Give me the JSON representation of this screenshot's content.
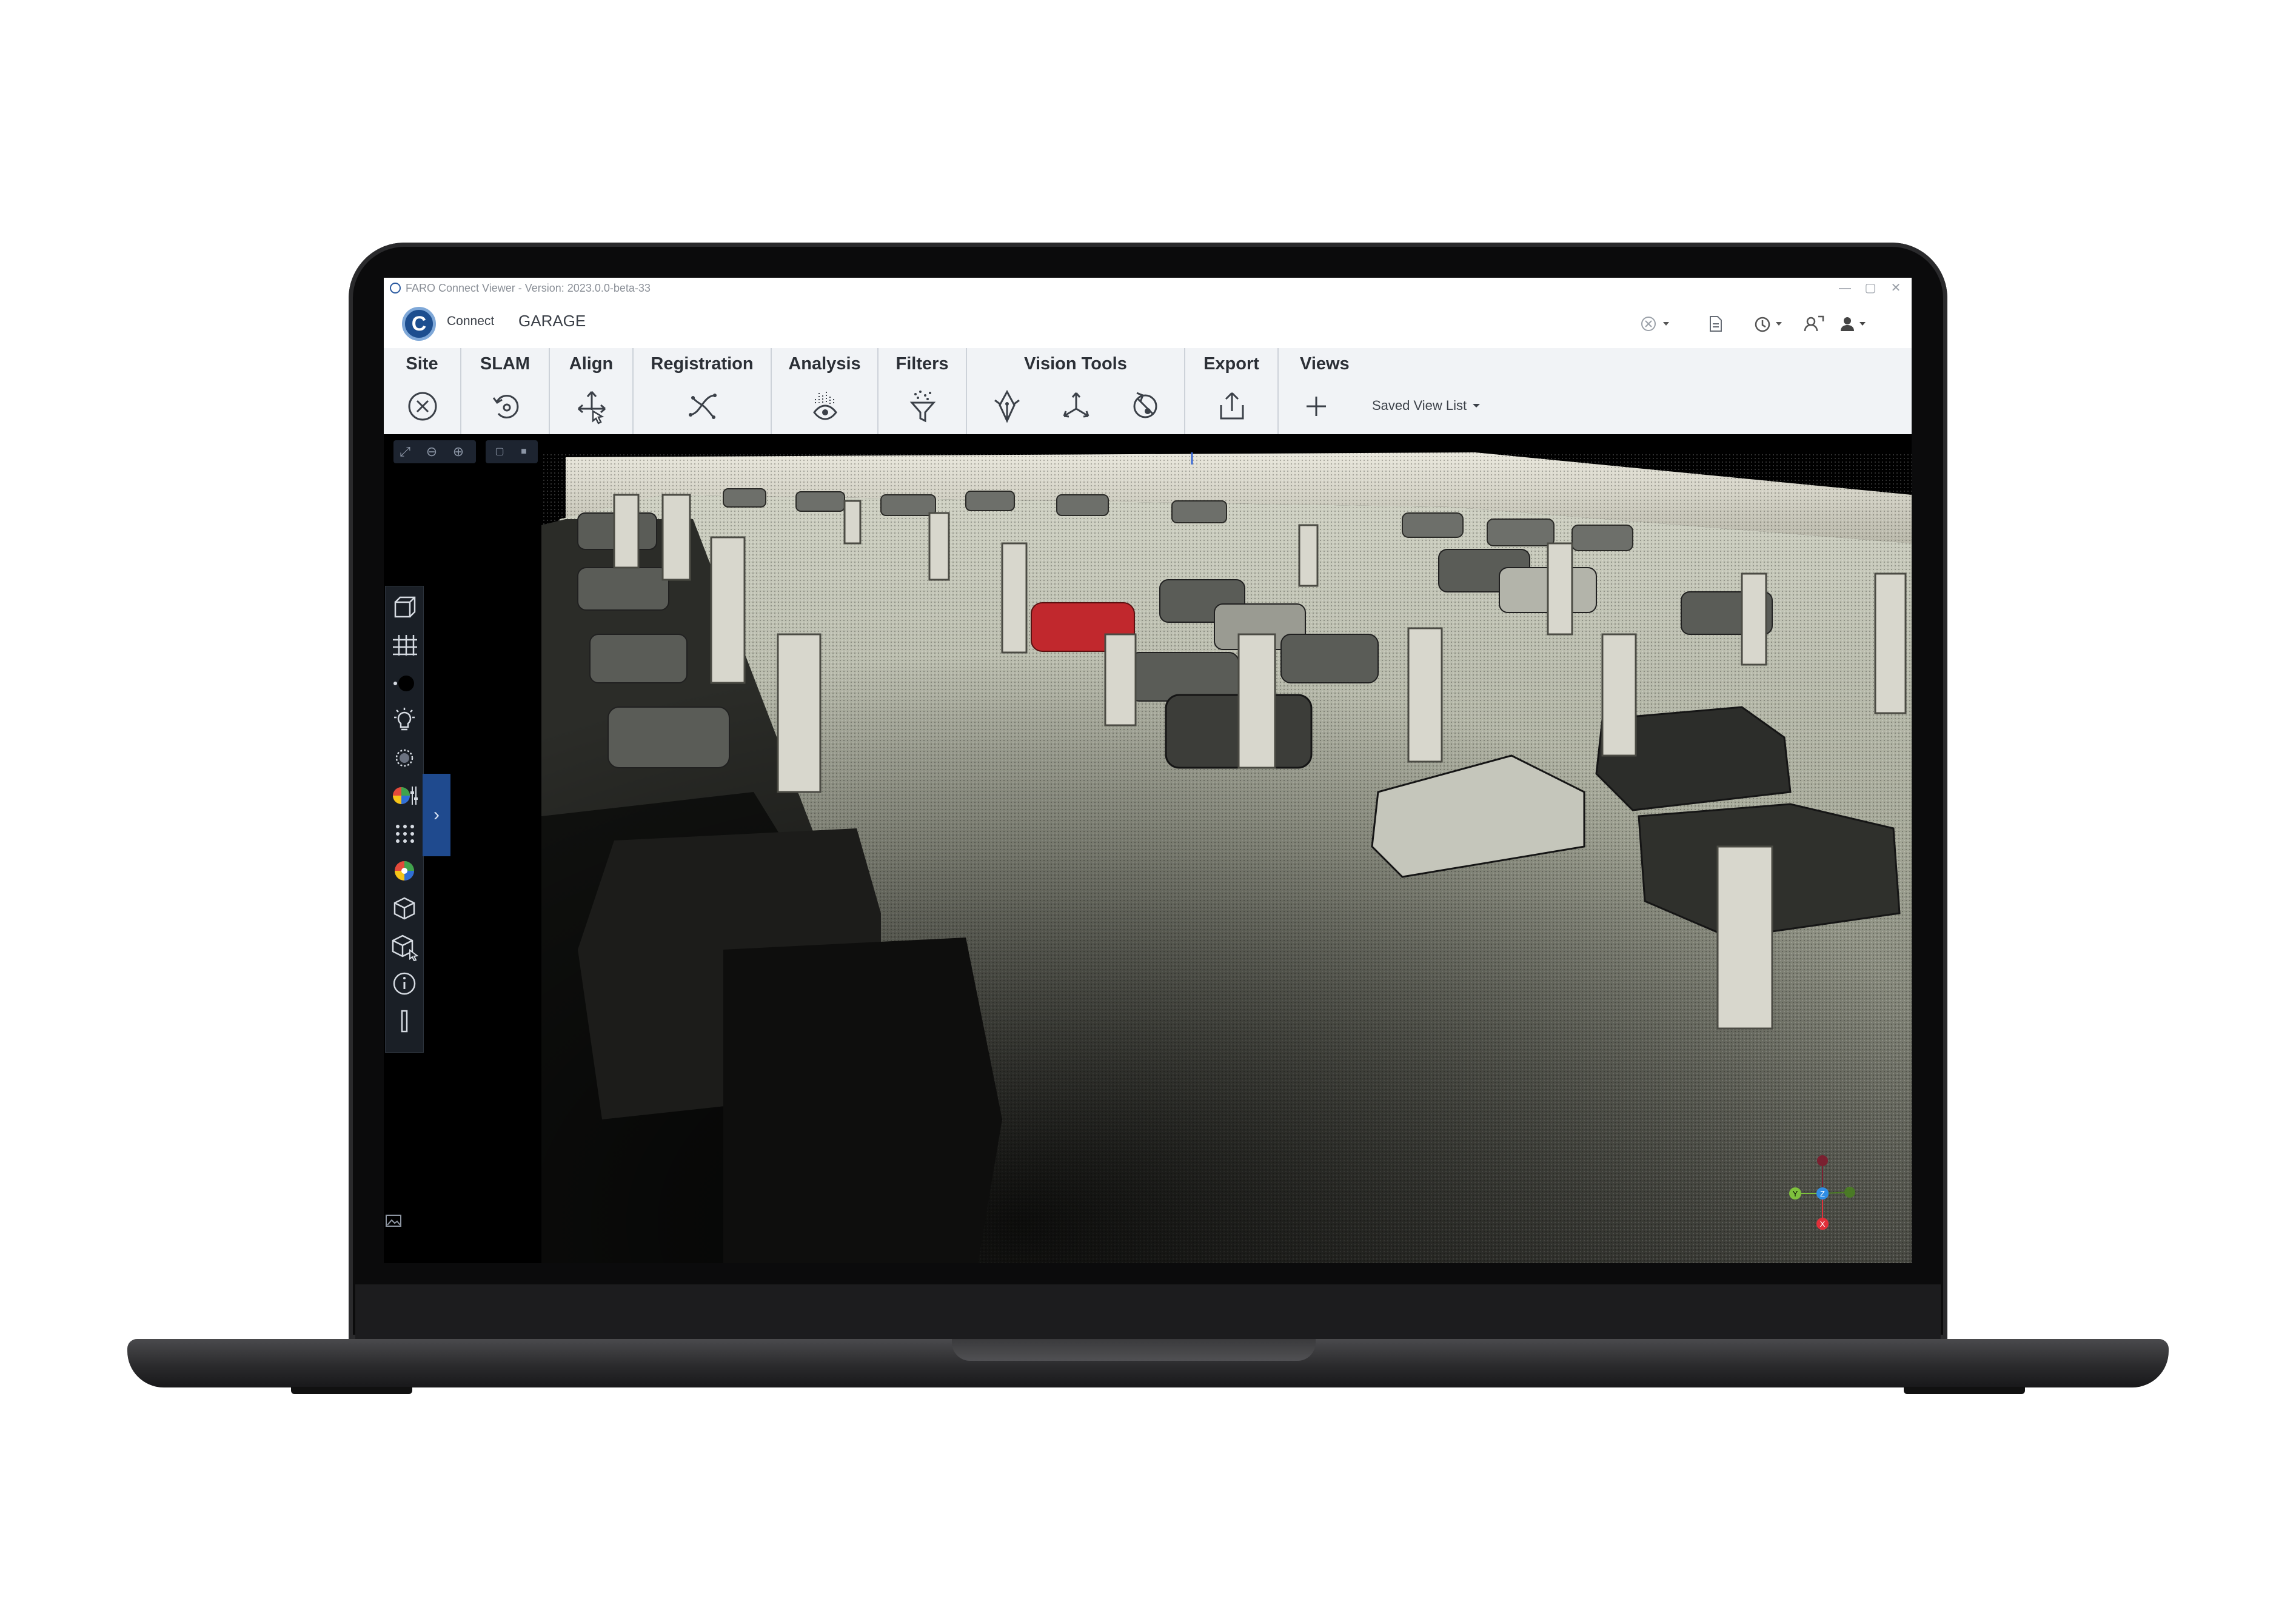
{
  "window": {
    "title": "FARO Connect Viewer - Version: 2023.0.0-beta-33",
    "controls": [
      "—",
      "▢",
      "✕"
    ]
  },
  "header": {
    "logo_letter": "C",
    "brand": "Connect",
    "project": "GARAGE"
  },
  "ribbon": {
    "groups": [
      {
        "label": "Site",
        "tools": [
          "close-site-icon"
        ]
      },
      {
        "label": "SLAM",
        "tools": [
          "slam-icon"
        ]
      },
      {
        "label": "Align",
        "tools": [
          "align-move-icon"
        ]
      },
      {
        "label": "Registration",
        "tools": [
          "registration-icon"
        ]
      },
      {
        "label": "Analysis",
        "tools": [
          "analysis-eye-icon"
        ]
      },
      {
        "label": "Filters",
        "tools": [
          "filter-icon"
        ]
      },
      {
        "label": "Vision Tools",
        "tools": [
          "pen-tool-icon",
          "axes-tool-icon",
          "measure-tool-icon"
        ]
      },
      {
        "label": "Export",
        "tools": [
          "export-icon"
        ]
      },
      {
        "label": "Views",
        "tools": [
          "add-view-icon"
        ],
        "saved_view_list": "Saved View List"
      }
    ]
  },
  "viewport": {
    "sidebar_tools": [
      "cube-view-icon",
      "grid-icon",
      "point-size-icon",
      "lighting-icon",
      "brightness-icon",
      "color-adjust-icon",
      "point-density-icon",
      "color-wheel-icon",
      "box-icon",
      "clipping-box-icon",
      "info-icon",
      "ruler-icon"
    ],
    "axes": {
      "x_color": "#e0303a",
      "y_color": "#7ec13d",
      "z_color": "#2f8de4"
    },
    "axis_labels": {
      "x": "X",
      "y": "Y",
      "z": "Z"
    }
  },
  "colors": {
    "accent": "#1f4a8e",
    "logo": "#1d4e8f",
    "highlight_car": "#c1282d"
  }
}
